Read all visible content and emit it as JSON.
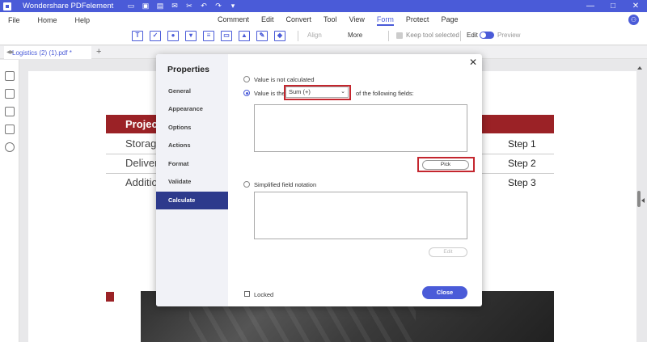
{
  "app": {
    "title": "Wondershare PDFelement",
    "window_controls": [
      "—",
      "□",
      "✕"
    ]
  },
  "menu": {
    "left": [
      "File",
      "Home",
      "Help"
    ],
    "main": [
      "Comment",
      "Edit",
      "Convert",
      "Tool",
      "View",
      "Form",
      "Protect",
      "Page"
    ],
    "active": "Form"
  },
  "toolbar": {
    "align_label": "Align",
    "more_label": "More",
    "keep_tool_label": "Keep tool selected",
    "edit_label": "Edit",
    "preview_label": "Preview"
  },
  "tab": {
    "label": "Logistics (2) (1).pdf *",
    "add": "+"
  },
  "document": {
    "header_text": "Project",
    "rows": [
      "Storage",
      "Delivery",
      "Additio"
    ],
    "steps": [
      "Step 1",
      "Step 2",
      "Step 3"
    ]
  },
  "dialog": {
    "title": "Properties",
    "nav": [
      "General",
      "Appearance",
      "Options",
      "Actions",
      "Format",
      "Validate",
      "Calculate"
    ],
    "active_nav": "Calculate",
    "option_not_calculated": "Value is not calculated",
    "option_value_is": "Value is the",
    "select_value": "Sum (+)",
    "following_fields": "of the following fields:",
    "pick_button": "Pick",
    "option_simplified": "Simplified field notation",
    "edit_button": "Edit",
    "locked_label": "Locked",
    "close_button": "Close",
    "close_icon": "✕"
  },
  "colors": {
    "accent": "#4a5bd8",
    "nav_active": "#2d3a8c",
    "highlight": "#c4262e",
    "doc_red": "#9b2226"
  }
}
